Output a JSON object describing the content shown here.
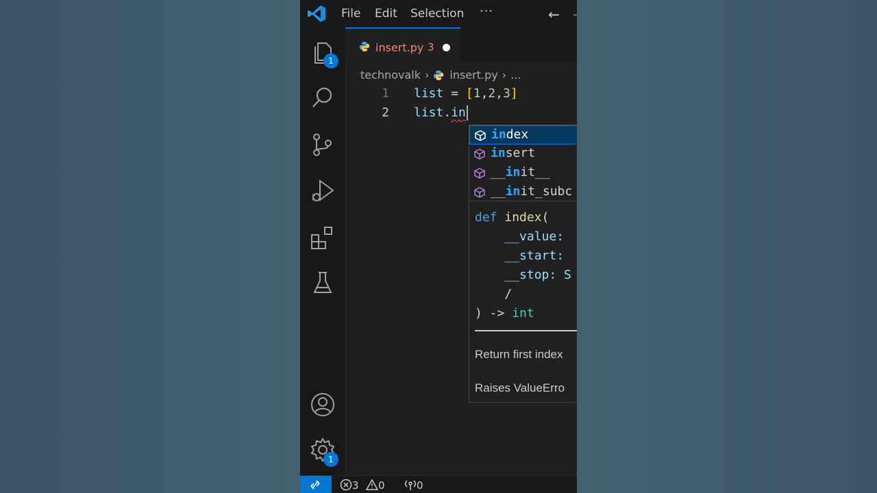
{
  "menu": {
    "file": "File",
    "edit": "Edit",
    "selection": "Selection",
    "more": "···"
  },
  "activity": {
    "explorer_badge": "1",
    "settings_badge": "1"
  },
  "tab": {
    "name": "insert.py",
    "problems": "3"
  },
  "breadcrumb": {
    "folder": "technovalk",
    "file": "insert.py",
    "more": "..."
  },
  "code": {
    "lines": [
      {
        "number": "1",
        "text": "list = [1,2,3]"
      },
      {
        "number": "2",
        "prefix": "list.",
        "typed": "in"
      }
    ]
  },
  "suggestions": [
    {
      "match": "in",
      "rest": "dex",
      "selected": true
    },
    {
      "match": "in",
      "rest": "sert",
      "selected": false
    },
    {
      "prefix": "__",
      "match": "in",
      "rest": "it__",
      "selected": false
    },
    {
      "prefix": "__",
      "match": "in",
      "rest": "it_subc",
      "selected": false
    }
  ],
  "details": {
    "signature": {
      "def": "def",
      "name": "index(",
      "params": [
        "__value:",
        "__start:",
        "__stop: S"
      ],
      "slash": "/",
      "close": ") ->",
      "return_type": "int"
    },
    "doc_line1": "Return first index",
    "doc_line2": "Raises ValueErro"
  },
  "status": {
    "errors": "3",
    "warnings": "0",
    "ports": "0"
  },
  "colors": {
    "accent": "#0078d4",
    "error": "#f48771",
    "background": "#3f5a6d"
  }
}
